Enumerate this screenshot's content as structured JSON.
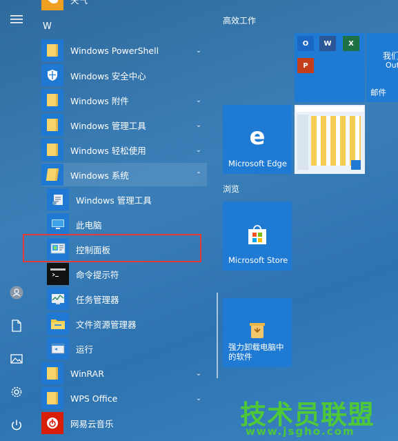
{
  "rail": {
    "items": [
      {
        "name": "hamburger-menu-icon"
      },
      {
        "name": "user-account-icon"
      },
      {
        "name": "documents-icon"
      },
      {
        "name": "pictures-icon"
      },
      {
        "name": "settings-gear-icon"
      },
      {
        "name": "power-icon"
      }
    ]
  },
  "applist": {
    "top_partial": "天气",
    "section_letter": "W",
    "items": [
      {
        "label": "Windows PowerShell",
        "type": "folder",
        "chevron": "down"
      },
      {
        "label": "Windows 安全中心",
        "type": "app",
        "icon": "shield-icon"
      },
      {
        "label": "Windows 附件",
        "type": "folder",
        "chevron": "down"
      },
      {
        "label": "Windows 管理工具",
        "type": "folder",
        "chevron": "down"
      },
      {
        "label": "Windows 轻松使用",
        "type": "folder",
        "chevron": "down"
      },
      {
        "label": "Windows 系统",
        "type": "folder",
        "chevron": "up",
        "expanded": true
      },
      {
        "label": "Windows 管理工具",
        "type": "app",
        "icon": "admin-tools-icon"
      },
      {
        "label": "此电脑",
        "type": "app",
        "icon": "this-pc-icon"
      },
      {
        "label": "控制面板",
        "type": "app",
        "icon": "control-panel-icon",
        "highlighted": true
      },
      {
        "label": "命令提示符",
        "type": "app",
        "icon": "command-prompt-icon"
      },
      {
        "label": "任务管理器",
        "type": "app",
        "icon": "task-manager-icon"
      },
      {
        "label": "文件资源管理器",
        "type": "app",
        "icon": "file-explorer-icon"
      },
      {
        "label": "运行",
        "type": "app",
        "icon": "run-icon"
      },
      {
        "label": "WinRAR",
        "type": "folder",
        "chevron": "down"
      },
      {
        "label": "WPS Office",
        "type": "folder",
        "chevron": "down"
      },
      {
        "label": "网易云音乐",
        "type": "app",
        "icon": "netease-music-icon"
      }
    ]
  },
  "tiles": {
    "group1_title": "高效工作",
    "group2_title": "浏览",
    "office_letters": [
      "O",
      "W",
      "X",
      "P"
    ],
    "mail_text": "我们",
    "mail_text2": "Out",
    "mail_label": "邮件",
    "edge_label": "Microsoft Edge",
    "store_label": "Microsoft Store",
    "uninstall_label": "强力卸载电脑中的软件"
  },
  "watermark": {
    "main": "技术员联盟",
    "url": "www.jsgho.com"
  },
  "colors": {
    "tile_blue": "#1f7ad4",
    "highlight_red": "#e53935",
    "watermark_green": "#4ec838",
    "folder_yellow": "#f6d46b"
  }
}
